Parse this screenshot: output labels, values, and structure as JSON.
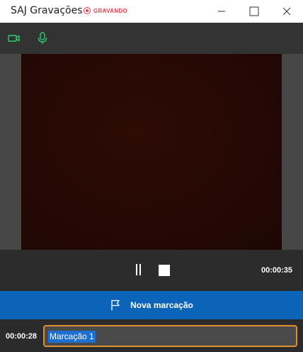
{
  "window": {
    "title": "SAJ Gravações",
    "status_label": "GRAVANDO",
    "status_color": "#e8404a"
  },
  "toolbar": {
    "icons": [
      "camera-icon",
      "microphone-icon"
    ],
    "accent_color": "#2ecc71"
  },
  "controls": {
    "elapsed": "00:00:35",
    "icons": [
      "pause-icon",
      "stop-icon"
    ]
  },
  "mark_bar": {
    "label": "Nova marcação",
    "icon": "flag-icon",
    "color": "#0b64b8"
  },
  "bookmark": {
    "timestamp": "00:00:28",
    "value": "Marcação 1",
    "border_color": "#e0902e"
  }
}
